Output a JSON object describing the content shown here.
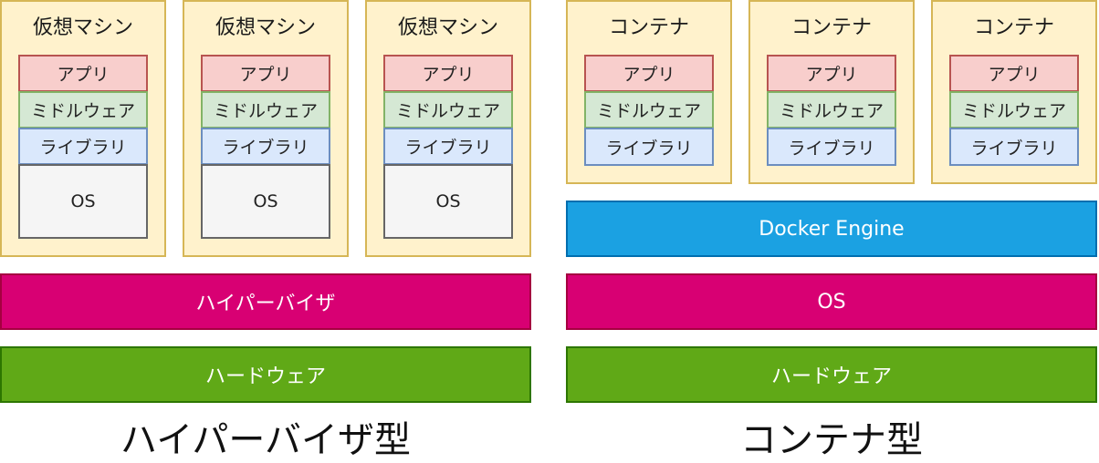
{
  "hypervisor_side": {
    "machines": [
      {
        "title": "仮想マシン",
        "layers": {
          "app": "アプリ",
          "middleware": "ミドルウェア",
          "library": "ライブラリ",
          "os": "OS"
        }
      },
      {
        "title": "仮想マシン",
        "layers": {
          "app": "アプリ",
          "middleware": "ミドルウェア",
          "library": "ライブラリ",
          "os": "OS"
        }
      },
      {
        "title": "仮想マシン",
        "layers": {
          "app": "アプリ",
          "middleware": "ミドルウェア",
          "library": "ライブラリ",
          "os": "OS"
        }
      }
    ],
    "hypervisor_label": "ハイパーバイザ",
    "hardware_label": "ハードウェア",
    "caption": "ハイパーバイザ型"
  },
  "container_side": {
    "containers": [
      {
        "title": "コンテナ",
        "layers": {
          "app": "アプリ",
          "middleware": "ミドルウェア",
          "library": "ライブラリ"
        }
      },
      {
        "title": "コンテナ",
        "layers": {
          "app": "アプリ",
          "middleware": "ミドルウェア",
          "library": "ライブラリ"
        }
      },
      {
        "title": "コンテナ",
        "layers": {
          "app": "アプリ",
          "middleware": "ミドルウェア",
          "library": "ライブラリ"
        }
      }
    ],
    "engine_label": "Docker Engine",
    "os_label": "OS",
    "hardware_label": "ハードウェア",
    "caption": "コンテナ型"
  },
  "colors": {
    "machine_fill": "#fff2cc",
    "machine_stroke": "#d6b656",
    "app_fill": "#f8cecc",
    "middleware_fill": "#d5e8d4",
    "library_fill": "#dae8fc",
    "os_fill": "#f5f5f5",
    "hypervisor_fill": "#d80073",
    "hardware_fill": "#60a917",
    "docker_fill": "#1ba1e2"
  }
}
